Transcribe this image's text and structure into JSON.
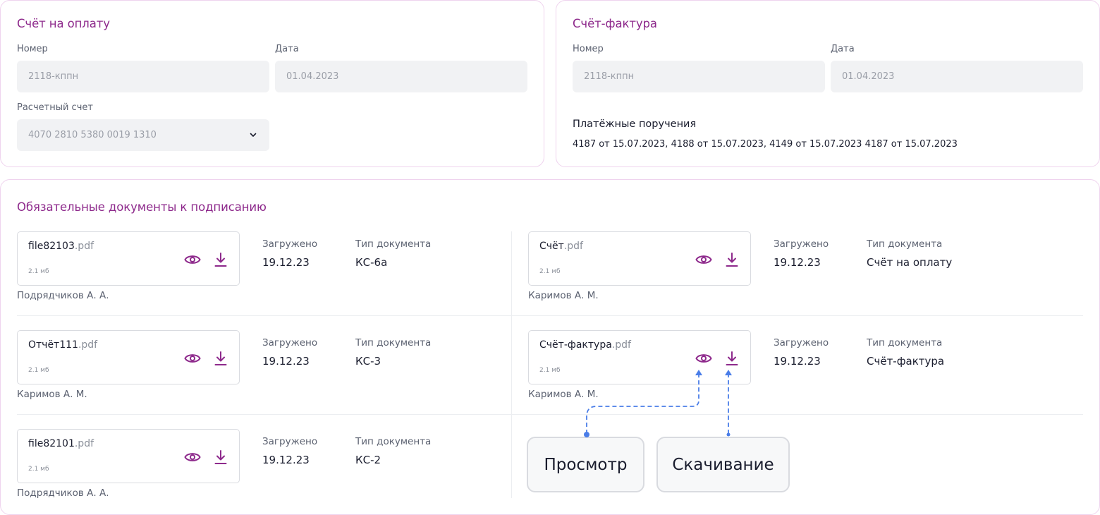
{
  "invoice": {
    "title": "Счёт на оплату",
    "number_label": "Номер",
    "number_value": "2118-кппн",
    "date_label": "Дата",
    "date_value": "01.04.2023",
    "account_label": "Расчетный счет",
    "account_value": "4070 2810 5380 0019 1310",
    "account_icon": "chevron-down-icon"
  },
  "facture": {
    "title": "Счёт-фактура",
    "number_label": "Номер",
    "number_value": "2118-кппн",
    "date_label": "Дата",
    "date_value": "01.04.2023",
    "payments_title": "Платёжные поручения",
    "payments_text": "4187 от 15.07.2023, 4188 от 15.07.2023, 4149 от 15.07.2023 4187 от 15.07.2023"
  },
  "docs": {
    "title": "Обязательные документы к подписанию",
    "uploaded_label": "Загружено",
    "type_label": "Тип документа",
    "items": [
      {
        "name": "file82103",
        "ext": ".pdf",
        "size": "2.1 мб",
        "author": "Подрядчиков А. А.",
        "uploaded": "19.12.23",
        "type": "КС-6а"
      },
      {
        "name": "Счёт",
        "ext": ".pdf",
        "size": "2.1 мб",
        "author": "Каримов А. М.",
        "uploaded": "19.12.23",
        "type": "Счёт на оплату"
      },
      {
        "name": "Отчёт111",
        "ext": ".pdf",
        "size": "2.1 мб",
        "author": "Каримов А. М.",
        "uploaded": "19.12.23",
        "type": "КС-3"
      },
      {
        "name": "Счёт-фактура",
        "ext": ".pdf",
        "size": "2.1 мб",
        "author": "Каримов А. М.",
        "uploaded": "19.12.23",
        "type": "Счёт-фактура"
      },
      {
        "name": "file82101",
        "ext": ".pdf",
        "size": "2.1 мб",
        "author": "Подрядчиков А. А.",
        "uploaded": "19.12.23",
        "type": "КС-2"
      }
    ]
  },
  "callouts": {
    "view": "Просмотр",
    "download": "Скачивание"
  },
  "colors": {
    "accent": "#8e2a8c",
    "border": "#efd3ee",
    "annotation": "#4a7de8"
  },
  "icons": {
    "view": "eye-icon",
    "download": "download-icon"
  }
}
